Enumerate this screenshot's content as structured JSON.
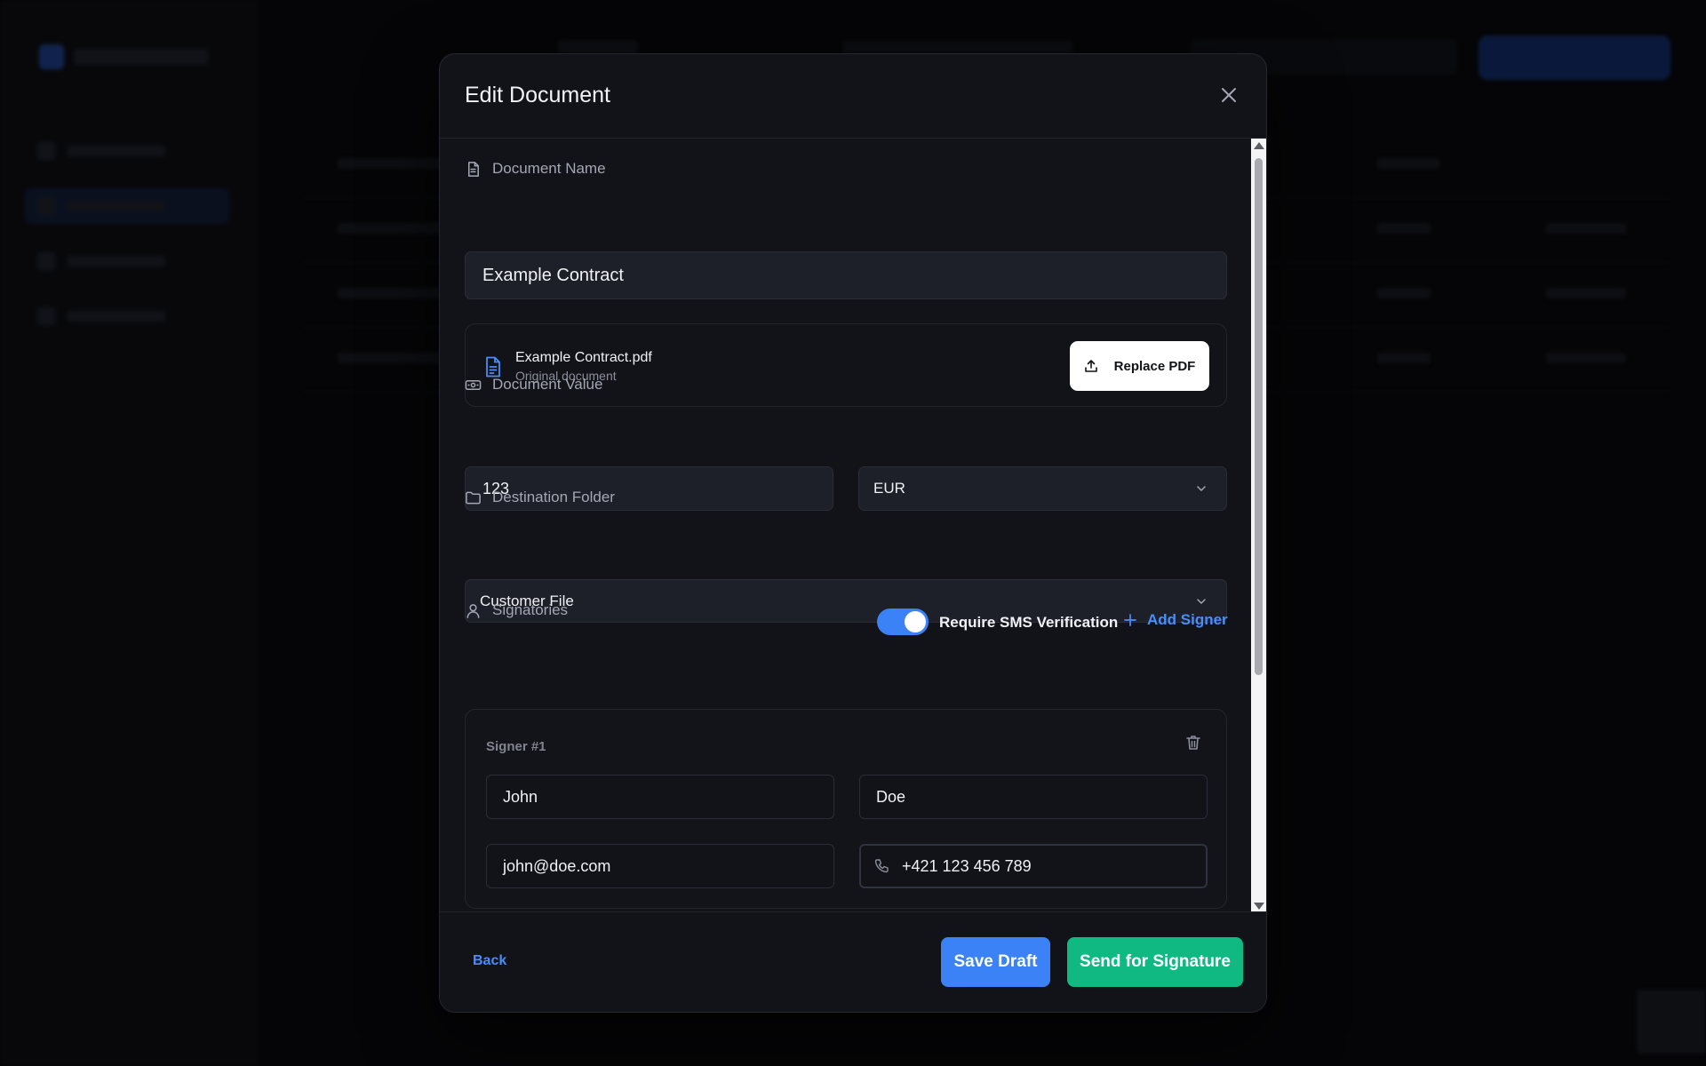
{
  "modal": {
    "title": "Edit Document",
    "document_name": {
      "label": "Document Name",
      "value": "Example Contract"
    },
    "file": {
      "name": "Example Contract.pdf",
      "subtitle": "Original document",
      "replace_label": "Replace PDF"
    },
    "document_value": {
      "label": "Document Value",
      "amount": "123",
      "currency": "EUR"
    },
    "destination_folder": {
      "label": "Destination Folder",
      "value": "Customer File"
    },
    "signatories": {
      "label": "Signatories",
      "sms_toggle_label": "Require SMS Verification",
      "sms_enabled": true,
      "add_signer_label": "Add Signer",
      "signers": [
        {
          "title": "Signer #1",
          "first_name": "John",
          "last_name": "Doe",
          "email": "john@doe.com",
          "phone": "+421 123 456 789"
        }
      ]
    },
    "footer": {
      "back_label": "Back",
      "save_draft_label": "Save Draft",
      "send_label": "Send for Signature"
    }
  },
  "colors": {
    "accent_blue": "#3b82f6",
    "accent_green": "#10b981",
    "modal_bg": "#121318",
    "input_bg": "#1e2029"
  },
  "icons": {
    "close": "close-icon",
    "document": "document-icon",
    "file": "file-text-icon",
    "upload": "upload-icon",
    "money": "banknote-icon",
    "folder": "folder-icon",
    "user": "user-icon",
    "plus": "plus-icon",
    "trash": "trash-icon",
    "phone": "phone-icon",
    "chevron": "chevron-down-icon"
  }
}
